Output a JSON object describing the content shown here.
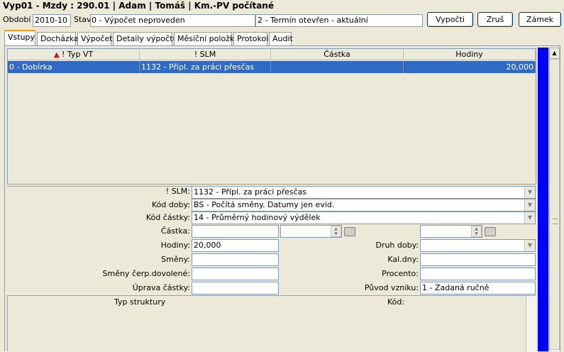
{
  "window_title": "Vyp01 - Mzdy : 290.01 | Adam | Tomáš | Km.-PV počítané",
  "header": {
    "obdobi_label": "Období",
    "obdobi_value": "2010-10",
    "stav_label": "Stav",
    "stav_value": "0 - Výpočet neproveden",
    "termin_value": "2 - Termín otevřen - aktuální",
    "btn_vypocti": "Vypočti",
    "btn_zrus": "Zruš",
    "btn_zamek": "Zámek"
  },
  "tabs": [
    {
      "label": "Vstupy",
      "active": true
    },
    {
      "label": "Docházka"
    },
    {
      "label": "Výpočet"
    },
    {
      "label": "Detaily výpočtu"
    },
    {
      "label": "Měsíční položky"
    },
    {
      "label": "Protokol"
    },
    {
      "label": "Audit"
    }
  ],
  "grid": {
    "columns": [
      "! Typ VT",
      "! SLM",
      "Částka",
      "Hodiny"
    ],
    "rows": [
      {
        "typ_vt": "0 - Dobírka",
        "slm": "1132 - Přípl. za práci přesčas",
        "castka": "",
        "hodiny": "20,000"
      }
    ]
  },
  "form": {
    "slm_label": "! SLM:",
    "slm_value": "1132 - Přípl. za práci přesčas",
    "kod_doby_label": "Kód doby:",
    "kod_doby_value": "BS - Počítá směny. Datumy jen evid.",
    "kod_castky_label": "Kód částky:",
    "kod_castky_value": "14 - Průměrný hodinový výdělek",
    "castka_label": "Částka:",
    "castka_value": "",
    "hodiny_label": "Hodiny:",
    "hodiny_value": "20,000",
    "smeny_label": "Směny:",
    "smeny_value": "",
    "smeny_cerp_label": "Směny čerp.dovolené:",
    "smeny_cerp_value": "",
    "uprava_label": "Úprava částky:",
    "uprava_value": "",
    "druh_doby_label": "Druh doby:",
    "druh_doby_value": "",
    "kal_dny_label": "Kal.dny:",
    "kal_dny_value": "",
    "procento_label": "Procento:",
    "procento_value": "",
    "puvod_label": "Původ vzniku:",
    "puvod_value": "1 - Zadaná ručně"
  },
  "structure": {
    "typ_struktury_label": "Typ struktury",
    "kod_label": "Kód:"
  },
  "colors": {
    "selection": "#316ac5",
    "scrollbar": "#0000ff",
    "tab_accent": "#ff9a00"
  },
  "icons": {
    "sort": "sort-up-arrow-icon",
    "dropdown": "chevron-down-icon",
    "calendar": "calendar-icon"
  }
}
